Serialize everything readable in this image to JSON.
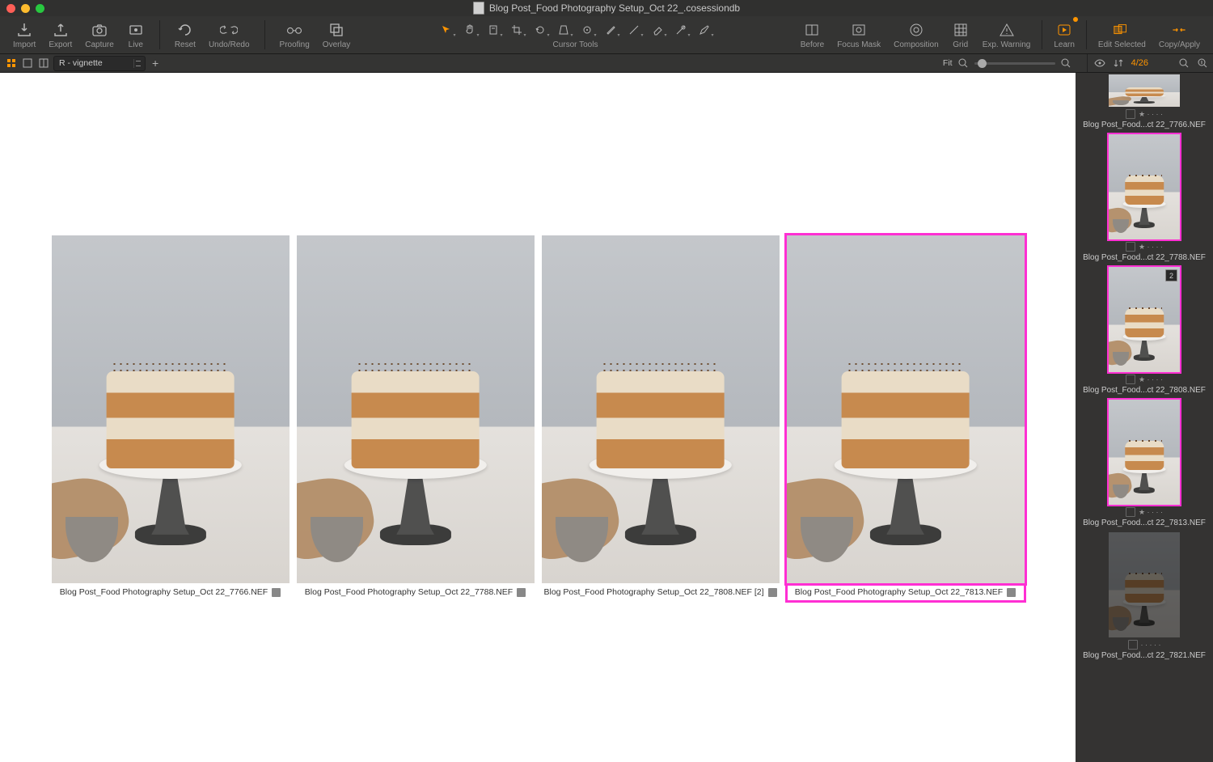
{
  "window": {
    "title": "Blog Post_Food Photography Setup_Oct 22_.cosessiondb"
  },
  "toolbar": {
    "import": "Import",
    "export": "Export",
    "capture": "Capture",
    "live": "Live",
    "reset": "Reset",
    "undoredo": "Undo/Redo",
    "proofing": "Proofing",
    "overlay": "Overlay",
    "cursor_tools": "Cursor Tools",
    "before": "Before",
    "focusmask": "Focus Mask",
    "composition": "Composition",
    "grid": "Grid",
    "expwarning": "Exp. Warning",
    "learn": "Learn",
    "editselected": "Edit Selected",
    "copyapply": "Copy/Apply"
  },
  "subbar": {
    "preset": "R - vignette",
    "fit": "Fit",
    "counter": "4/26"
  },
  "viewer": {
    "images": [
      {
        "caption": "Blog Post_Food Photography Setup_Oct 22_7766.NEF",
        "selected": false,
        "bowl_left": "2%"
      },
      {
        "caption": "Blog Post_Food Photography Setup_Oct 22_7788.NEF",
        "selected": false,
        "bowl_left": "14%"
      },
      {
        "caption": "Blog Post_Food Photography Setup_Oct 22_7808.NEF [2]",
        "selected": false,
        "bowl_left": "8%"
      },
      {
        "caption": "Blog Post_Food Photography Setup_Oct 22_7813.NEF",
        "selected": true,
        "bowl_left": "6%"
      }
    ]
  },
  "sidebar": {
    "thumbs": [
      {
        "name": "Blog Post_Food...ct 22_7766.NEF",
        "stars": 1,
        "selected": false,
        "variant": null,
        "partial": true
      },
      {
        "name": "Blog Post_Food...ct 22_7788.NEF",
        "stars": 1,
        "selected": true,
        "variant": null
      },
      {
        "name": "Blog Post_Food...ct 22_7808.NEF",
        "stars": 1,
        "selected": true,
        "variant": "2"
      },
      {
        "name": "Blog Post_Food...ct 22_7813.NEF",
        "stars": 1,
        "selected": true,
        "variant": null
      },
      {
        "name": "Blog Post_Food...ct 22_7821.NEF",
        "stars": 0,
        "selected": false,
        "variant": null,
        "dark": true
      }
    ]
  }
}
